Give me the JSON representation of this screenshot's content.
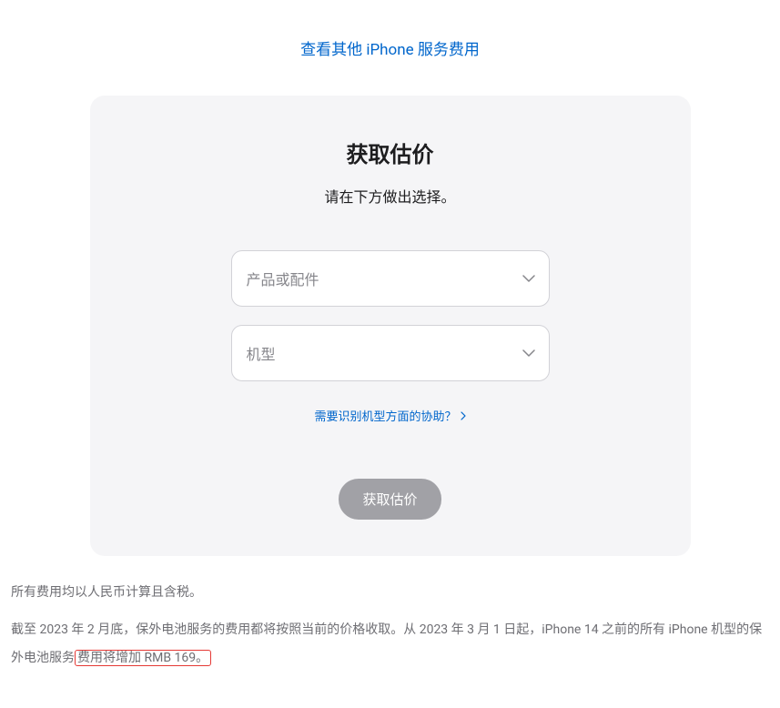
{
  "topLink": "查看其他 iPhone 服务费用",
  "card": {
    "title": "获取估价",
    "subtitle": "请在下方做出选择。",
    "select1": {
      "placeholder": "产品或配件"
    },
    "select2": {
      "placeholder": "机型"
    },
    "helpLink": "需要识别机型方面的协助？",
    "submitLabel": "获取估价"
  },
  "footer": {
    "line1": "所有费用均以人民币计算且含税。",
    "line2a": "截至 2023 年 2 月底，保外电池服务的费用都将按照当前的价格收取。从 2023 年 3 月 1 日起，iPhone 14 之前的所有 iPhone 机型的保外电池服务",
    "line2b": "费用将增加 RMB 169。"
  }
}
